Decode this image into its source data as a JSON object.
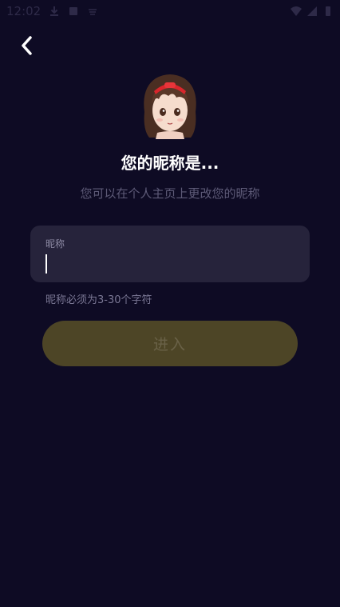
{
  "status_bar": {
    "time": "12:02"
  },
  "header": {
    "title": "您的昵称是...",
    "subtitle": "您可以在个人主页上更改您的昵称"
  },
  "nickname_field": {
    "label": "昵称",
    "value": "",
    "hint": "昵称必须为3-30个字符"
  },
  "enter_button": {
    "label": "进入"
  },
  "colors": {
    "background": "#0e0b24",
    "field_background": "#26233b",
    "button_background": "#4d4526",
    "button_text": "#6a6248",
    "muted_text": "#5e5b78"
  },
  "icons": {
    "back": "chevron-left-icon",
    "avatar": "girl-avatar-icon"
  }
}
